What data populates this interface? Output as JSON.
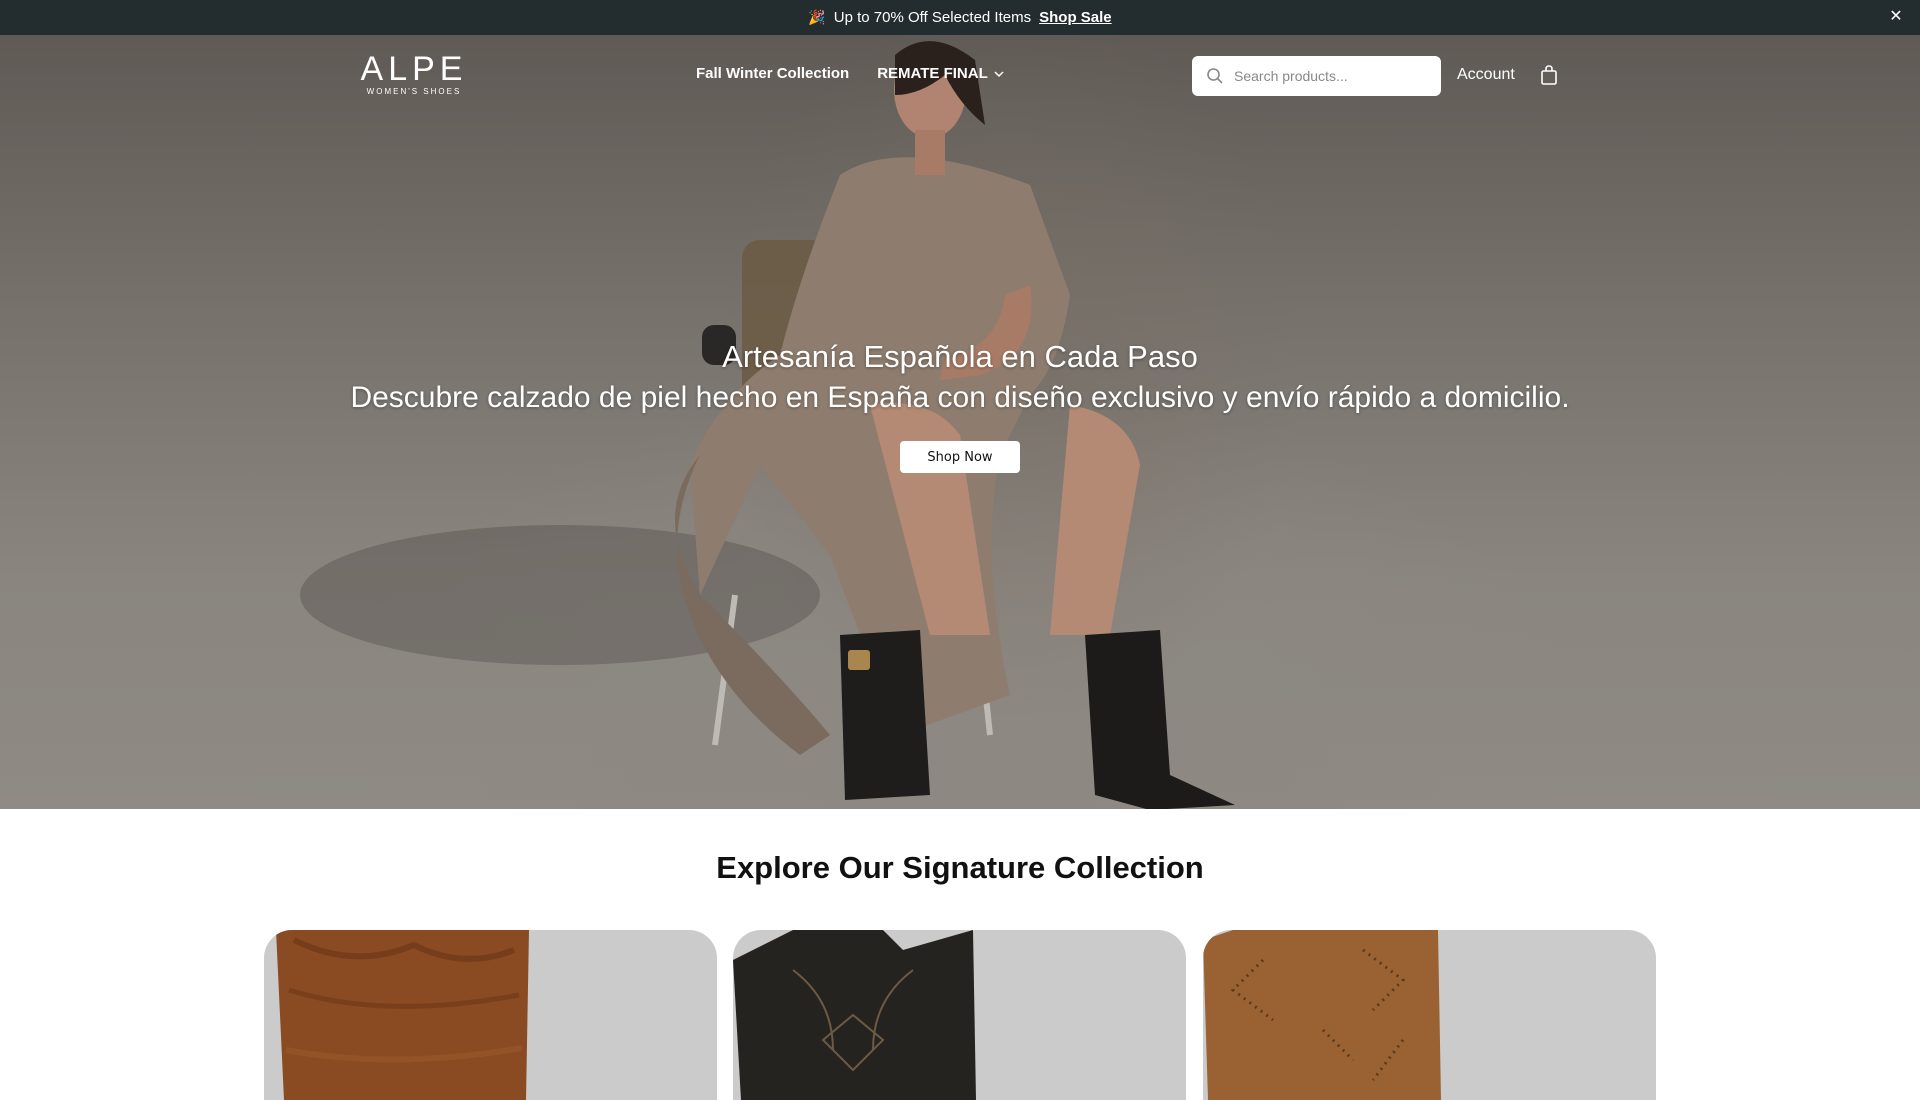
{
  "announcement": {
    "emoji": "🎉",
    "text": "Up to 70% Off Selected Items",
    "link": "Shop Sale",
    "close_icon": "close-icon"
  },
  "header": {
    "logo": {
      "brand": "ALPE",
      "tagline": "WOMEN'S SHOES"
    },
    "nav": [
      {
        "label": "Fall Winter Collection"
      },
      {
        "label": "REMATE FINAL",
        "icon": "chevron-down-icon"
      }
    ],
    "search": {
      "placeholder": "Search products...",
      "value": "",
      "icon": "search-icon"
    },
    "account_label": "Account",
    "cart_icon": "shopping-bag-icon"
  },
  "hero": {
    "title": "Artesanía Española en Cada Paso",
    "subtitle": "Descubre calzado de piel hecho en España con diseño exclusivo y envío rápido a domicilio.",
    "cta": "Shop Now"
  },
  "collection": {
    "title": "Explore Our Signature Collection",
    "cards": [
      {
        "boot": "brown suede slouch boot"
      },
      {
        "boot": "black leather western boot"
      },
      {
        "boot": "tan suede studded western boot"
      }
    ]
  },
  "colors": {
    "announce_bg": "#232c2f",
    "card_bg": "#cbcbcb",
    "text_dark": "#111111"
  }
}
